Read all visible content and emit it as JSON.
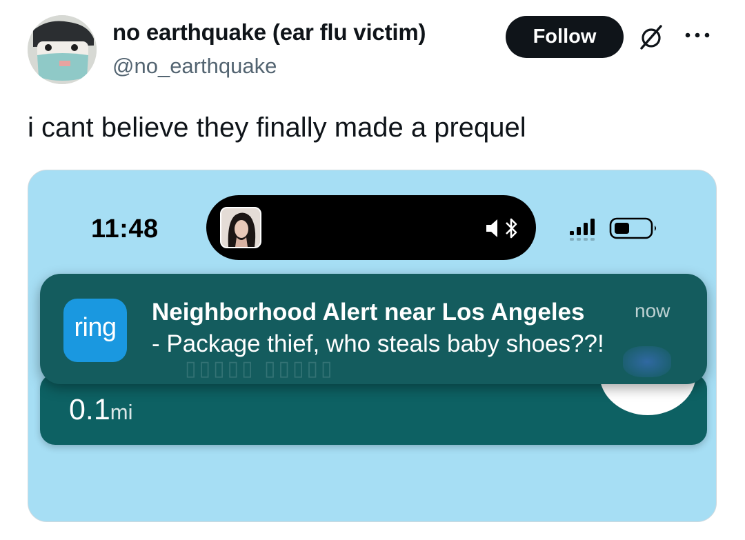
{
  "author": {
    "display_name": "no earthquake (ear flu victim)",
    "handle": "@no_earthquake"
  },
  "actions": {
    "follow_label": "Follow",
    "grok_icon": "grok-icon",
    "more_icon": "more-options-icon"
  },
  "tweet": {
    "text": "i cant believe they finally made a prequel"
  },
  "media": {
    "status_bar": {
      "time": "11:48",
      "icons": [
        "signal-icon",
        "battery-icon"
      ],
      "battery_level": 0.6
    },
    "dynamic_island": {
      "icons": [
        "album-art",
        "speaker-icon",
        "bluetooth-icon"
      ]
    },
    "notification": {
      "app_label": "ring",
      "title": "Neighborhood Alert near Los Angeles",
      "time": "now",
      "body": "- Package thief, who steals baby shoes??!"
    },
    "card": {
      "distance_value": "0.1",
      "distance_unit": "mi"
    },
    "colors": {
      "background": "#a6def4",
      "notification": "#145c5e",
      "card": "#0d6163",
      "ring_blue": "#1a98e0"
    }
  }
}
